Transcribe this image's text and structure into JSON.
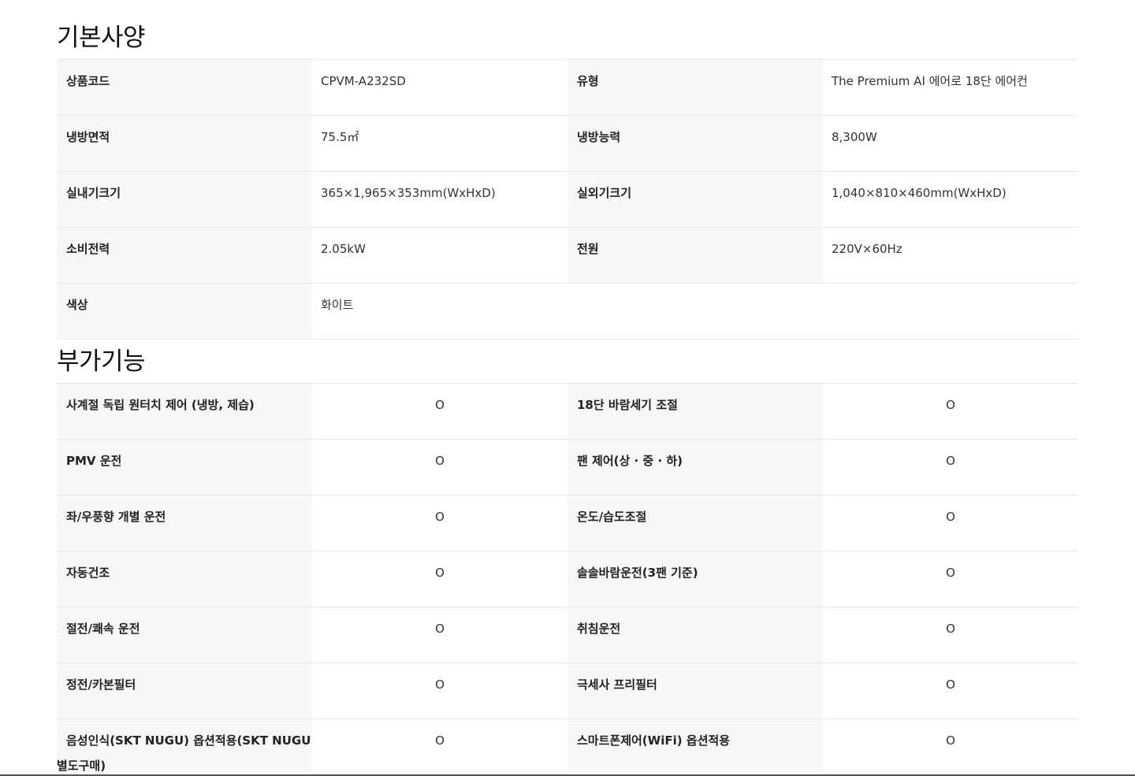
{
  "basic_specs": {
    "title": "기본사양",
    "rows": [
      {
        "label1": "상품코드",
        "value1": "CPVM-A232SD",
        "label2": "유형",
        "value2": "The Premium AI 에어로 18단 에어컨"
      },
      {
        "label1": "냉방면적",
        "value1": "75.5㎡",
        "label2": "냉방능력",
        "value2": "8,300W"
      },
      {
        "label1": "실내기크기",
        "value1": "365×1,965×353mm(WxHxD)",
        "label2": "실외기크기",
        "value2": "1,040×810×460mm(WxHxD)"
      },
      {
        "label1": "소비전력",
        "value1": "2.05kW",
        "label2": "전원",
        "value2": "220V×60Hz"
      },
      {
        "label1": "색상",
        "value1": "화이트"
      }
    ]
  },
  "extra_features": {
    "title": "부가기능",
    "rows": [
      {
        "label1": "사계절 독립 원터치 제어 (냉방, 제습)",
        "value1": "O",
        "label2": "18단 바람세기 조절",
        "value2": "O"
      },
      {
        "label1": "PMV 운전",
        "value1": "O",
        "label2": "팬 제어(상 · 중 · 하)",
        "value2": "O"
      },
      {
        "label1": "좌/우풍향 개별 운전",
        "value1": "O",
        "label2": "온도/습도조절",
        "value2": "O"
      },
      {
        "label1": "자동건조",
        "value1": "O",
        "label2": "솔솔바람운전(3팬 기준)",
        "value2": "O"
      },
      {
        "label1": "절전/쾌속 운전",
        "value1": "O",
        "label2": "취침운전",
        "value2": "O"
      },
      {
        "label1": "정전/카본필터",
        "value1": "O",
        "label2": "극세사 프리필터",
        "value2": "O"
      },
      {
        "label1": "음성인식(SKT NUGU) 옵션적용(SKT NUGU 별도구매)",
        "value1": "O",
        "label2": "스마트폰제어(WiFi) 옵션적용",
        "value2": "O"
      }
    ]
  }
}
